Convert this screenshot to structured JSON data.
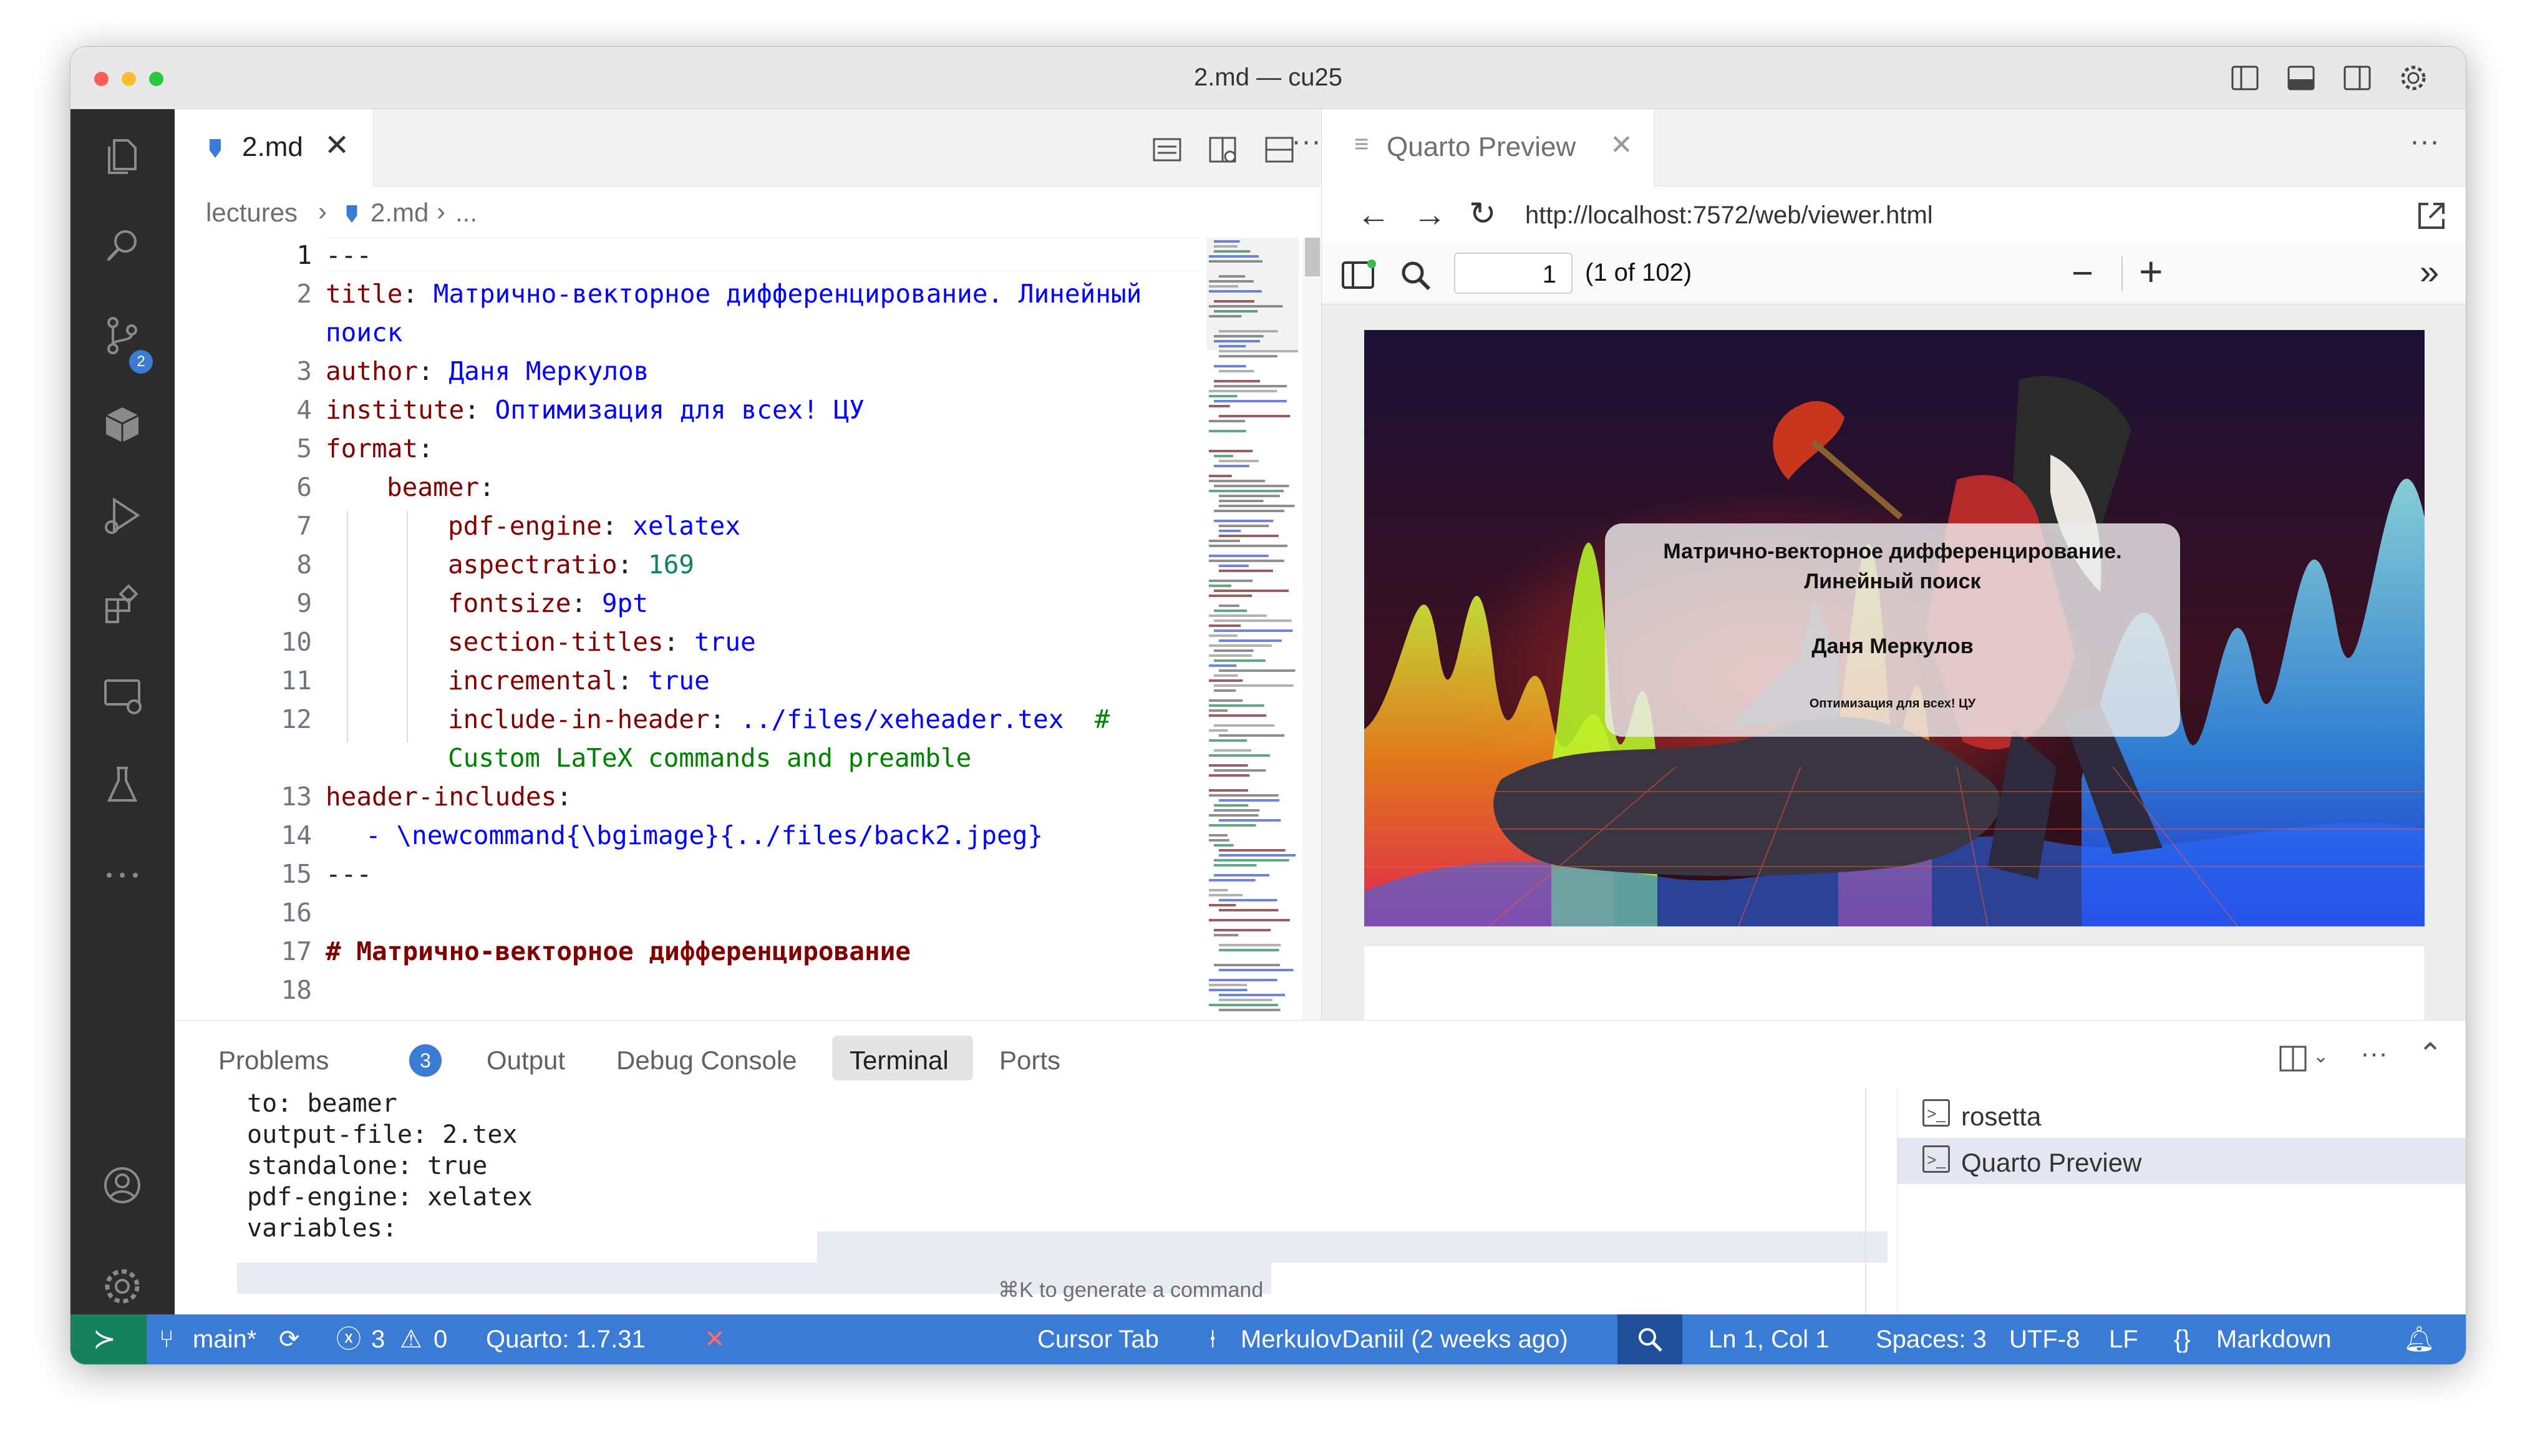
{
  "window": {
    "title": "2.md — cu25"
  },
  "editor": {
    "tab": {
      "label": "2.md"
    },
    "breadcrumb": [
      "lectures",
      "2.md",
      "..."
    ],
    "lines": [
      {
        "n": "1",
        "text": "---"
      },
      {
        "n": "2",
        "key": "title",
        "value": "Матрично-векторное дифференцирование. Линейный",
        "cont": "поиск"
      },
      {
        "n": "3",
        "key": "author",
        "value": "Даня Меркулов"
      },
      {
        "n": "4",
        "key": "institute",
        "value": "Оптимизация для всех! ЦУ"
      },
      {
        "n": "5",
        "key": "format",
        "value": ""
      },
      {
        "n": "6",
        "key": "beamer",
        "value": ""
      },
      {
        "n": "7",
        "key": "pdf-engine",
        "value": "xelatex"
      },
      {
        "n": "8",
        "key": "aspectratio",
        "value": "169"
      },
      {
        "n": "9",
        "key": "fontsize",
        "value": "9pt"
      },
      {
        "n": "10",
        "key": "section-titles",
        "value": "true"
      },
      {
        "n": "11",
        "key": "incremental",
        "value": "true"
      },
      {
        "n": "12",
        "key": "include-in-header",
        "value": "../files/xeheader.tex",
        "comment": "#",
        "cont": "Custom LaTeX commands and preamble"
      },
      {
        "n": "13",
        "key": "header-includes",
        "value": ""
      },
      {
        "n": "14",
        "text": "- \\newcommand{\\bgimage}{../files/back2.jpeg}"
      },
      {
        "n": "15",
        "text": "---"
      },
      {
        "n": "16",
        "text": ""
      },
      {
        "n": "17",
        "text": "# Матрично-векторное дифференцирование"
      },
      {
        "n": "18",
        "text": ""
      }
    ]
  },
  "preview": {
    "tab": {
      "label": "Quarto Preview"
    },
    "url": "http://localhost:7572/web/viewer.html",
    "page_input": "1",
    "page_count": "(1 of 102)",
    "slide": {
      "title_line1": "Матрично-векторное дифференцирование.",
      "title_line2": "Линейный поиск",
      "author": "Даня Меркулов",
      "institute": "Оптимизация для всех! ЦУ"
    }
  },
  "panel": {
    "tabs": [
      "Problems",
      "Output",
      "Debug Console",
      "Terminal",
      "Ports"
    ],
    "problems_badge": "3",
    "active_tab": "Terminal",
    "terminal_lines": [
      "to: beamer",
      "output-file: 2.tex",
      "standalone: true",
      "pdf-engine: xelatex",
      "variables:"
    ],
    "hint": "⌘K to generate a command",
    "terminals": [
      "rosetta",
      "Quarto Preview"
    ]
  },
  "status": {
    "branch": "main*",
    "errors": "3",
    "warnings": "0",
    "quarto": "Quarto: 1.7.31",
    "cursor_tab": "Cursor Tab",
    "blame": "MerkulovDaniil (2 weeks ago)",
    "position": "Ln 1, Col 1",
    "spaces": "Spaces: 3",
    "encoding": "UTF-8",
    "eol": "LF",
    "language": "Markdown",
    "colors": {
      "bar": "#3a7bd5",
      "remote": "#16825d"
    }
  },
  "activity": {
    "scm_badge": "2"
  }
}
